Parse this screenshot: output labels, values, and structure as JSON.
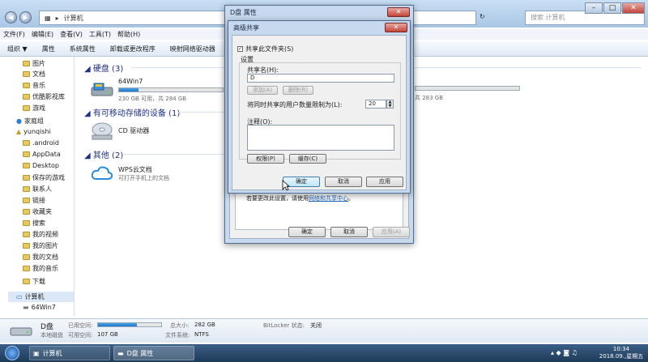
{
  "address": {
    "crumb": "计算机",
    "search_placeholder": "搜索 计算机"
  },
  "menu": [
    "文件(F)",
    "编辑(E)",
    "查看(V)",
    "工具(T)",
    "帮助(H)"
  ],
  "toolbar": [
    "组织 ▼",
    "属性",
    "系统属性",
    "卸载或更改程序",
    "映射网络驱动器"
  ],
  "nav": {
    "items": [
      "图片",
      "文档",
      "音乐",
      "优酷影视库",
      "游戏",
      "家庭组",
      "yunqishi",
      ".android",
      "AppData",
      "Desktop",
      "保存的游戏",
      "联系人",
      "链接",
      "收藏夹",
      "搜索",
      "我的视频",
      "我的图片",
      "我的文档",
      "我的音乐",
      "下载",
      "计算机",
      "64Win7"
    ]
  },
  "groups": {
    "hdd": "硬盘 (3)",
    "removable": "有可移动存储的设备 (1)",
    "other": "其他 (2)"
  },
  "drives": {
    "d": {
      "name": "64Win7",
      "size": "230 GB 可用，共 284 GB",
      "fill": 0.19
    },
    "right_size": "共 283 GB",
    "cd": "CD 驱动器",
    "wps_name": "WPS云文档",
    "wps_desc": "可打开手机上的文档"
  },
  "details": {
    "name": "D盘",
    "type": "本地磁盘",
    "used_label": "已用空间:",
    "free_label": "可用空间:",
    "free": "107 GB",
    "total_label": "总大小:",
    "total": "282 GB",
    "fs_label": "文件系统:",
    "fs": "NTFS",
    "bitlocker_label": "BitLocker 状态:",
    "bitlocker": "关闭",
    "fill": 0.62
  },
  "props_dialog": {
    "title": "D盘 属性",
    "hint_prefix": "若要更改此设置，请使用",
    "hint_link": "网络和共享中心",
    "hint_suffix": "。",
    "ok": "确定",
    "cancel": "取消",
    "apply": "应用(A)"
  },
  "adv_dialog": {
    "title": "高级共享",
    "share_checkbox": "共享此文件夹(S)",
    "settings": "设置",
    "share_name_label": "共享名(H):",
    "share_name": "D",
    "add": "添加(A)",
    "remove": "删除(R)",
    "limit_label": "将同时共享的用户数量限制为(L):",
    "limit_value": "20",
    "comment_label": "注释(O):",
    "permissions": "权限(P)",
    "caching": "缓存(C)",
    "ok": "确定",
    "cancel": "取消",
    "apply": "应用"
  },
  "taskbar": {
    "item1": "计算机",
    "item2": "D盘 属性",
    "time": "10:34",
    "date": "2018.09.,星期五"
  }
}
